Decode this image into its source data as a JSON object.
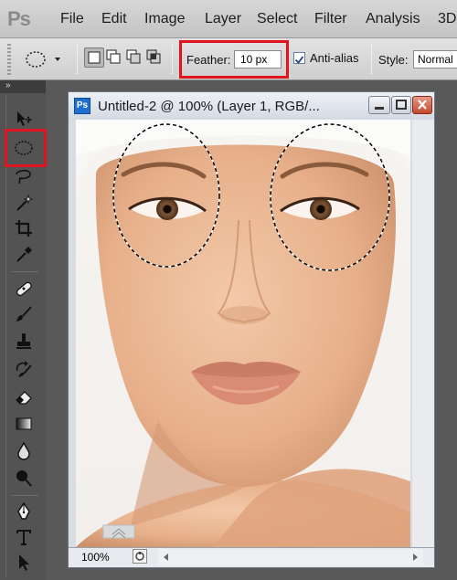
{
  "app": {
    "logo": "Ps",
    "menu": [
      "File",
      "Edit",
      "Image",
      "Layer",
      "Select",
      "Filter",
      "Analysis",
      "3D"
    ]
  },
  "options_bar": {
    "feather_label": "Feather:",
    "feather_value": "10 px",
    "antialias_label": "Anti-alias",
    "antialias_checked": true,
    "style_label": "Style:",
    "style_value": "Normal"
  },
  "tools_panel": {
    "collapse_glyph": "»",
    "active_tool": "elliptical-marquee"
  },
  "document": {
    "badge": "Ps",
    "title": "Untitled-2 @ 100% (Layer 1, RGB/...",
    "zoom": "100%"
  },
  "colors": {
    "highlight": "#e0141e",
    "ps_blue": "#1f6fd1"
  }
}
